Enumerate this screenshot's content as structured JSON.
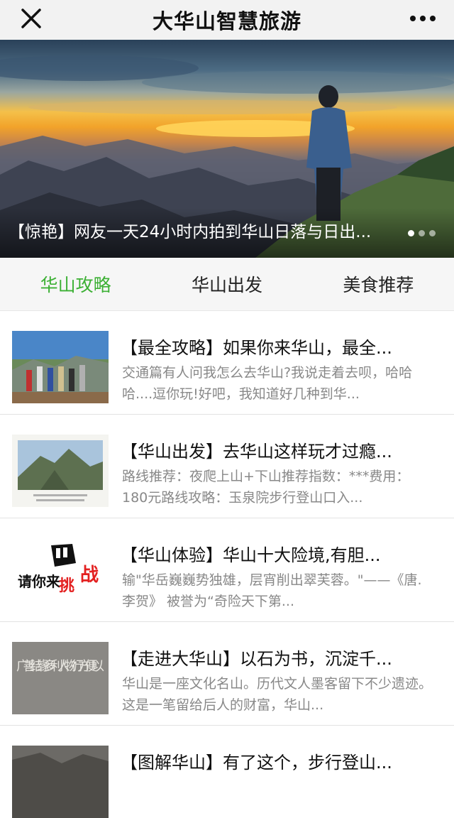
{
  "navbar": {
    "title": "大华山智慧旅游",
    "close_icon": "close-icon",
    "more_icon": "more-icon"
  },
  "banner": {
    "caption": "【惊艳】网友一天24小时内拍到华山日落与日出...",
    "slide_count": 3,
    "active_slide": 1
  },
  "tabs": [
    {
      "label": "华山攻略",
      "active": true
    },
    {
      "label": "华山出发",
      "active": false
    },
    {
      "label": "美食推荐",
      "active": false
    }
  ],
  "articles": [
    {
      "title": "【最全攻略】如果你来华山，最全...",
      "desc": "交通篇有人问我怎么去华山?我说走着去呗，哈哈哈....逗你玩!好吧，我知道好几种到华..."
    },
    {
      "title": "【华山出发】去华山这样玩才过瘾...",
      "desc": "路线推荐：夜爬上山+下山推荐指数：***费用：180元路线攻略：玉泉院步行登山口入..."
    },
    {
      "title": "【华山体验】华山十大险境,有胆...",
      "desc": "输\"华岳巍巍势独雄，层宵削出翠芙蓉。\"——《唐.李贺》 被誉为“奇险天下第..."
    },
    {
      "title": "【走进大华山】以石为书，沉淀千...",
      "desc": "华山是一座文化名山。历代文人墨客留下不少遗迹。这是一笔留给后人的财富，华山..."
    },
    {
      "title": "【图解华山】有了这个，步行登山..."
    }
  ],
  "thumb_text": {
    "challenge_a": "请你来",
    "challenge_b": "挑",
    "challenge_c": "战",
    "stone": "广善结缘多利人物行方便以"
  },
  "colors": {
    "accent": "#3cb034",
    "navbar_bg": "#f2f2f2",
    "text_secondary": "#888888"
  }
}
